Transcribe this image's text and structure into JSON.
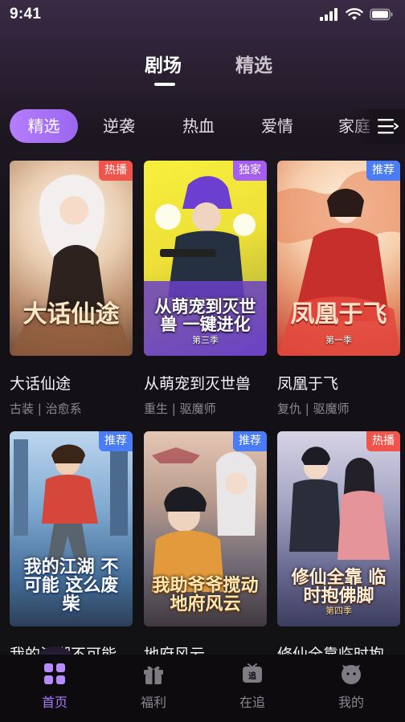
{
  "status_bar": {
    "time": "9:41"
  },
  "top_tabs": {
    "active": "剧场",
    "inactive": "精选"
  },
  "categories": [
    "精选",
    "逆袭",
    "热血",
    "爱情",
    "家庭"
  ],
  "cards": [
    {
      "title": "大话仙途",
      "tags": "古装 | 治愈系",
      "badge": "热播",
      "cover_text": "大话仙途",
      "cover_sub": "",
      "colors": [
        "#f4e6d6",
        "#c59a76",
        "#6b4a3a"
      ]
    },
    {
      "title": "从萌宠到灭世兽",
      "tags": "重生 | 驱魔师",
      "badge": "独家",
      "cover_text": "从萌宠到灭世兽 一键进化",
      "cover_sub": "第三季",
      "colors": [
        "#f4ea3c",
        "#7b47c9",
        "#2a2333"
      ]
    },
    {
      "title": "凤凰于飞",
      "tags": "复仇 | 驱魔师",
      "badge": "推荐",
      "cover_text": "凤凰于飞",
      "cover_sub": "第一季",
      "colors": [
        "#fbe3c9",
        "#e08560",
        "#c0312c"
      ]
    },
    {
      "title": "我的江湖不可能这么废柴",
      "tags": "",
      "badge": "推荐",
      "cover_text": "我的江湖 不可能 这么废柴",
      "cover_sub": "",
      "colors": [
        "#7fb4e6",
        "#3d6c9c",
        "#c24a3a"
      ]
    },
    {
      "title": "地府风云",
      "tags": "",
      "badge": "推荐",
      "cover_text": "我助爷爷搅动 地府风云",
      "cover_sub": "",
      "colors": [
        "#d9b9a6",
        "#6f6f78",
        "#e0a354"
      ]
    },
    {
      "title": "修仙全靠临时抱佛脚",
      "tags": "",
      "badge": "热播",
      "cover_text": "修仙全靠 临时抱佛脚",
      "cover_sub": "第四季",
      "colors": [
        "#a7a9c9",
        "#5b5d84",
        "#d88a8a"
      ]
    }
  ],
  "tabbar": {
    "home": "首页",
    "welfare": "福利",
    "following": "在追",
    "mine": "我的"
  },
  "accent": "#a778ff"
}
